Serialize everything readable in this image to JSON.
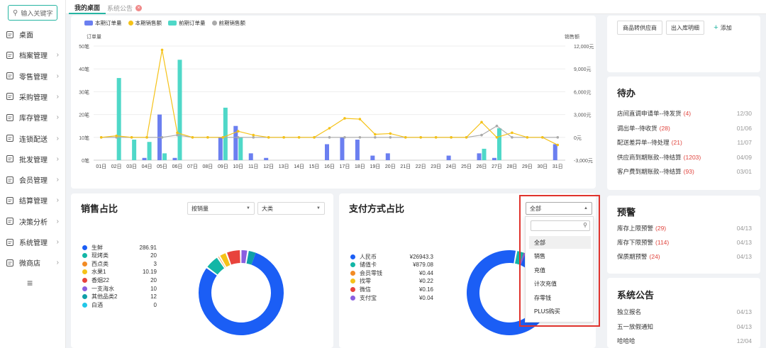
{
  "sidebar": {
    "search_placeholder": "输入关键字",
    "items": [
      {
        "label": "桌面",
        "icon": "desktop-icon",
        "chevron": false
      },
      {
        "label": "档案管理",
        "icon": "file-icon",
        "chevron": true
      },
      {
        "label": "零售管理",
        "icon": "retail-icon",
        "chevron": true
      },
      {
        "label": "采购管理",
        "icon": "purchase-icon",
        "chevron": true
      },
      {
        "label": "库存管理",
        "icon": "inventory-icon",
        "chevron": true
      },
      {
        "label": "连锁配送",
        "icon": "delivery-icon",
        "chevron": true
      },
      {
        "label": "批发管理",
        "icon": "wholesale-icon",
        "chevron": true
      },
      {
        "label": "会员管理",
        "icon": "member-icon",
        "chevron": true
      },
      {
        "label": "结算管理",
        "icon": "settlement-icon",
        "chevron": true
      },
      {
        "label": "决策分析",
        "icon": "analysis-icon",
        "chevron": true
      },
      {
        "label": "系统管理",
        "icon": "gear-icon",
        "chevron": true
      },
      {
        "label": "微商店",
        "icon": "shop-icon",
        "chevron": true
      }
    ]
  },
  "tabs": [
    {
      "label": "我的桌面",
      "active": true
    },
    {
      "label": "系统公告",
      "active": false
    }
  ],
  "chart_data": [
    {
      "type": "bar",
      "legend": [
        "本期订单量",
        "本期销售额",
        "前期订单量",
        "前期销售额"
      ],
      "ylabel_left": "订单量",
      "ylabel_right": "销售额",
      "y_left_ticks": [
        "0笔",
        "10笔",
        "20笔",
        "30笔",
        "40笔",
        "50笔"
      ],
      "y_right_ticks": [
        "-3,000元",
        "0元",
        "3,000元",
        "6,000元",
        "9,000元",
        "12,000元"
      ],
      "ylim_left": [
        0,
        50
      ],
      "ylim_right": [
        -3000,
        12000
      ],
      "categories": [
        "01日",
        "02日",
        "03日",
        "04日",
        "05日",
        "06日",
        "07日",
        "08日",
        "09日",
        "10日",
        "11日",
        "12日",
        "13日",
        "14日",
        "15日",
        "16日",
        "17日",
        "18日",
        "19日",
        "20日",
        "21日",
        "22日",
        "23日",
        "24日",
        "25日",
        "26日",
        "27日",
        "28日",
        "29日",
        "30日",
        "31日"
      ],
      "series": [
        {
          "name": "本期订单量",
          "kind": "bar",
          "axis": "left",
          "color": "#6b7ff0",
          "values": [
            0,
            0,
            0,
            1,
            20,
            1,
            0,
            0,
            10,
            15,
            3,
            1,
            0,
            0,
            0,
            7,
            10,
            9,
            2,
            3,
            0,
            0,
            0,
            2,
            0,
            3,
            1,
            0,
            0,
            0,
            7
          ]
        },
        {
          "name": "前期订单量",
          "kind": "bar",
          "axis": "left",
          "color": "#4fd8c8",
          "values": [
            0,
            36,
            9,
            8,
            3,
            44,
            0,
            0,
            23,
            10,
            0,
            0,
            0,
            0,
            0,
            0,
            0,
            0,
            0,
            0,
            0,
            0,
            0,
            0,
            0,
            5,
            14,
            0,
            0,
            0,
            0
          ]
        },
        {
          "name": "本期销售额",
          "kind": "line",
          "axis": "right",
          "color": "#f5c218",
          "values": [
            0,
            200,
            0,
            0,
            11500,
            600,
            0,
            0,
            0,
            800,
            300,
            0,
            0,
            0,
            0,
            1200,
            2500,
            2400,
            400,
            500,
            0,
            0,
            0,
            0,
            0,
            2000,
            0,
            600,
            0,
            0,
            -1000
          ]
        },
        {
          "name": "前期销售额",
          "kind": "line",
          "axis": "right",
          "color": "#aaaaaa",
          "values": [
            0,
            0,
            0,
            0,
            0,
            300,
            0,
            0,
            0,
            0,
            0,
            0,
            0,
            0,
            0,
            0,
            0,
            0,
            0,
            0,
            0,
            0,
            0,
            0,
            0,
            300,
            1500,
            0,
            0,
            0,
            0
          ]
        }
      ]
    },
    {
      "type": "pie",
      "title": "销售占比",
      "categories": [
        "生鲜",
        "现烤类",
        "西点类",
        "水果1",
        "香烟22",
        "一支海水",
        "其他品类2",
        "白酒"
      ],
      "values": [
        286.91,
        20,
        3,
        10.19,
        20,
        10,
        12,
        0
      ],
      "value_labels": [
        "286.91",
        "20",
        "3",
        "10.19",
        "20",
        "10",
        "12",
        "0"
      ],
      "colors": [
        "#1b5ef5",
        "#13b6a6",
        "#f28b24",
        "#f5c218",
        "#e8433c",
        "#8a5ee0",
        "#0f9fa8",
        "#21c7e8"
      ]
    },
    {
      "type": "pie",
      "title": "支付方式占比",
      "categories": [
        "人民币",
        "储值卡",
        "会员零钱",
        "找零",
        "微信",
        "支付宝"
      ],
      "value_labels": [
        "¥26943.3",
        "¥879.08",
        "¥0.44",
        "¥0.22",
        "¥0.16",
        "¥0.04"
      ],
      "values": [
        26943.3,
        879.08,
        0.44,
        0.22,
        0.16,
        0.04
      ],
      "colors": [
        "#1b5ef5",
        "#13b6a6",
        "#f28b24",
        "#f5c218",
        "#e8433c",
        "#8a5ee0"
      ]
    }
  ],
  "sales_card": {
    "title": "销售占比",
    "select1": "按销量",
    "select2": "大类"
  },
  "pay_card": {
    "title": "支付方式占比",
    "select": "全部",
    "dropdown_options": [
      "全部",
      "销售",
      "充值",
      "计次充值",
      "存零钱",
      "PLUS购买"
    ]
  },
  "quick_actions": {
    "btn1": "商品转供应商",
    "btn2": "出入库明细",
    "add": "添加"
  },
  "todo": {
    "title": "待办",
    "items": [
      {
        "label": "店间直调申请单--待发货",
        "count": "(4)",
        "date": "12/30"
      },
      {
        "label": "调出单--待收货",
        "count": "(28)",
        "date": "01/06"
      },
      {
        "label": "配送差异单--待处理",
        "count": "(21)",
        "date": "11/07"
      },
      {
        "label": "供应商到期账款--待结算",
        "count": "(1203)",
        "date": "04/09"
      },
      {
        "label": "客户费到期账款--待结算",
        "count": "(93)",
        "date": "03/01"
      }
    ]
  },
  "warn": {
    "title": "预警",
    "items": [
      {
        "label": "库存上限预警",
        "count": "(29)",
        "date": "04/13"
      },
      {
        "label": "库存下限预警",
        "count": "(114)",
        "date": "04/13"
      },
      {
        "label": "保质期预警",
        "count": "(24)",
        "date": "04/13"
      }
    ]
  },
  "notice": {
    "title": "系统公告",
    "items": [
      {
        "label": "独立报名",
        "date": "04/13"
      },
      {
        "label": "五一放假通知",
        "date": "04/13"
      },
      {
        "label": "哈哈哈",
        "date": "12/04"
      }
    ]
  }
}
